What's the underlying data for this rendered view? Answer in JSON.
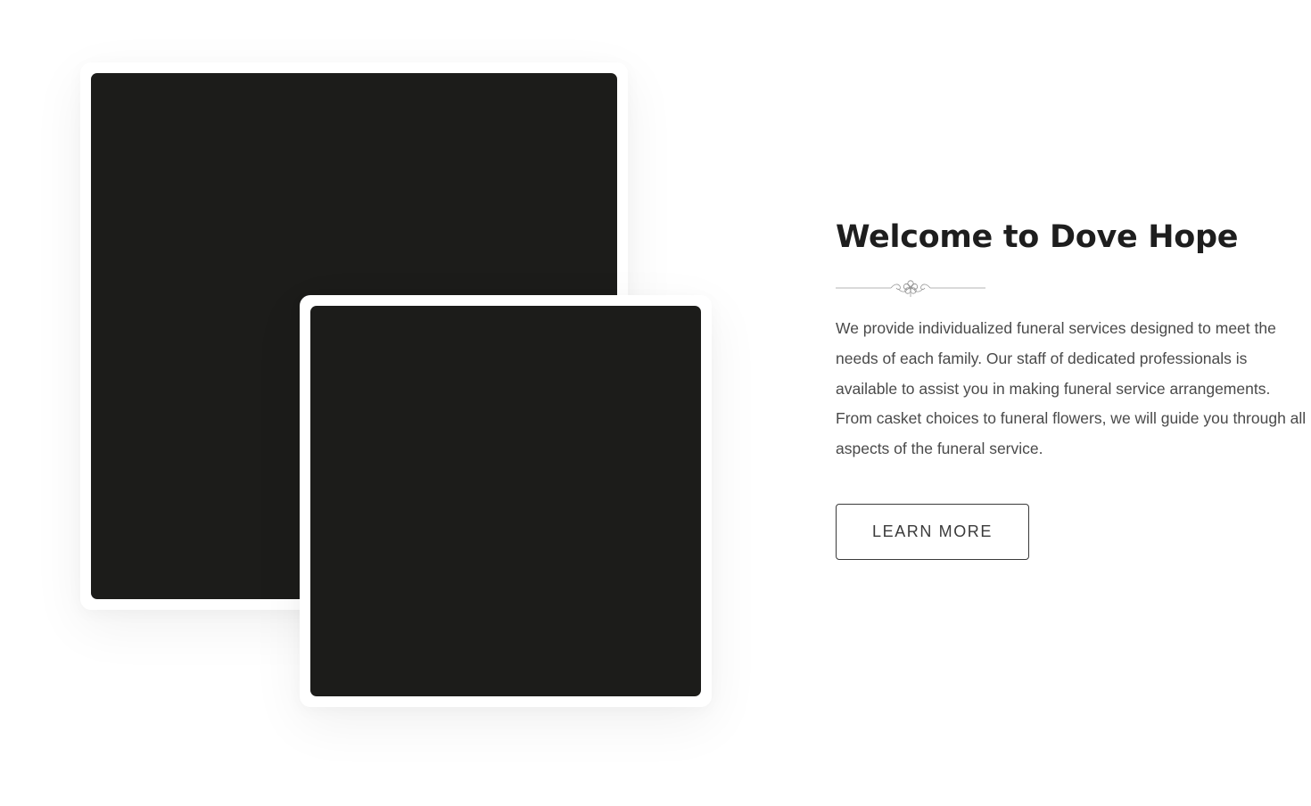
{
  "welcome": {
    "title": "Welcome to Dove Hope",
    "divider_icon": "floral-divider-icon",
    "body": "We provide individualized funeral services designed to meet the needs of each family. Our staff of dedicated professionals is available to assist you in making funeral service arrangements. From casket choices to funeral flowers, we will guide you through all aspects of the funeral service.",
    "button_label": "LEARN MORE"
  },
  "colors": {
    "photo_placeholder": "#1c1c1a",
    "heading": "#1e1e1e",
    "body_text": "#4a4a4a",
    "button_border": "#3a3a3a",
    "background": "#ffffff"
  }
}
